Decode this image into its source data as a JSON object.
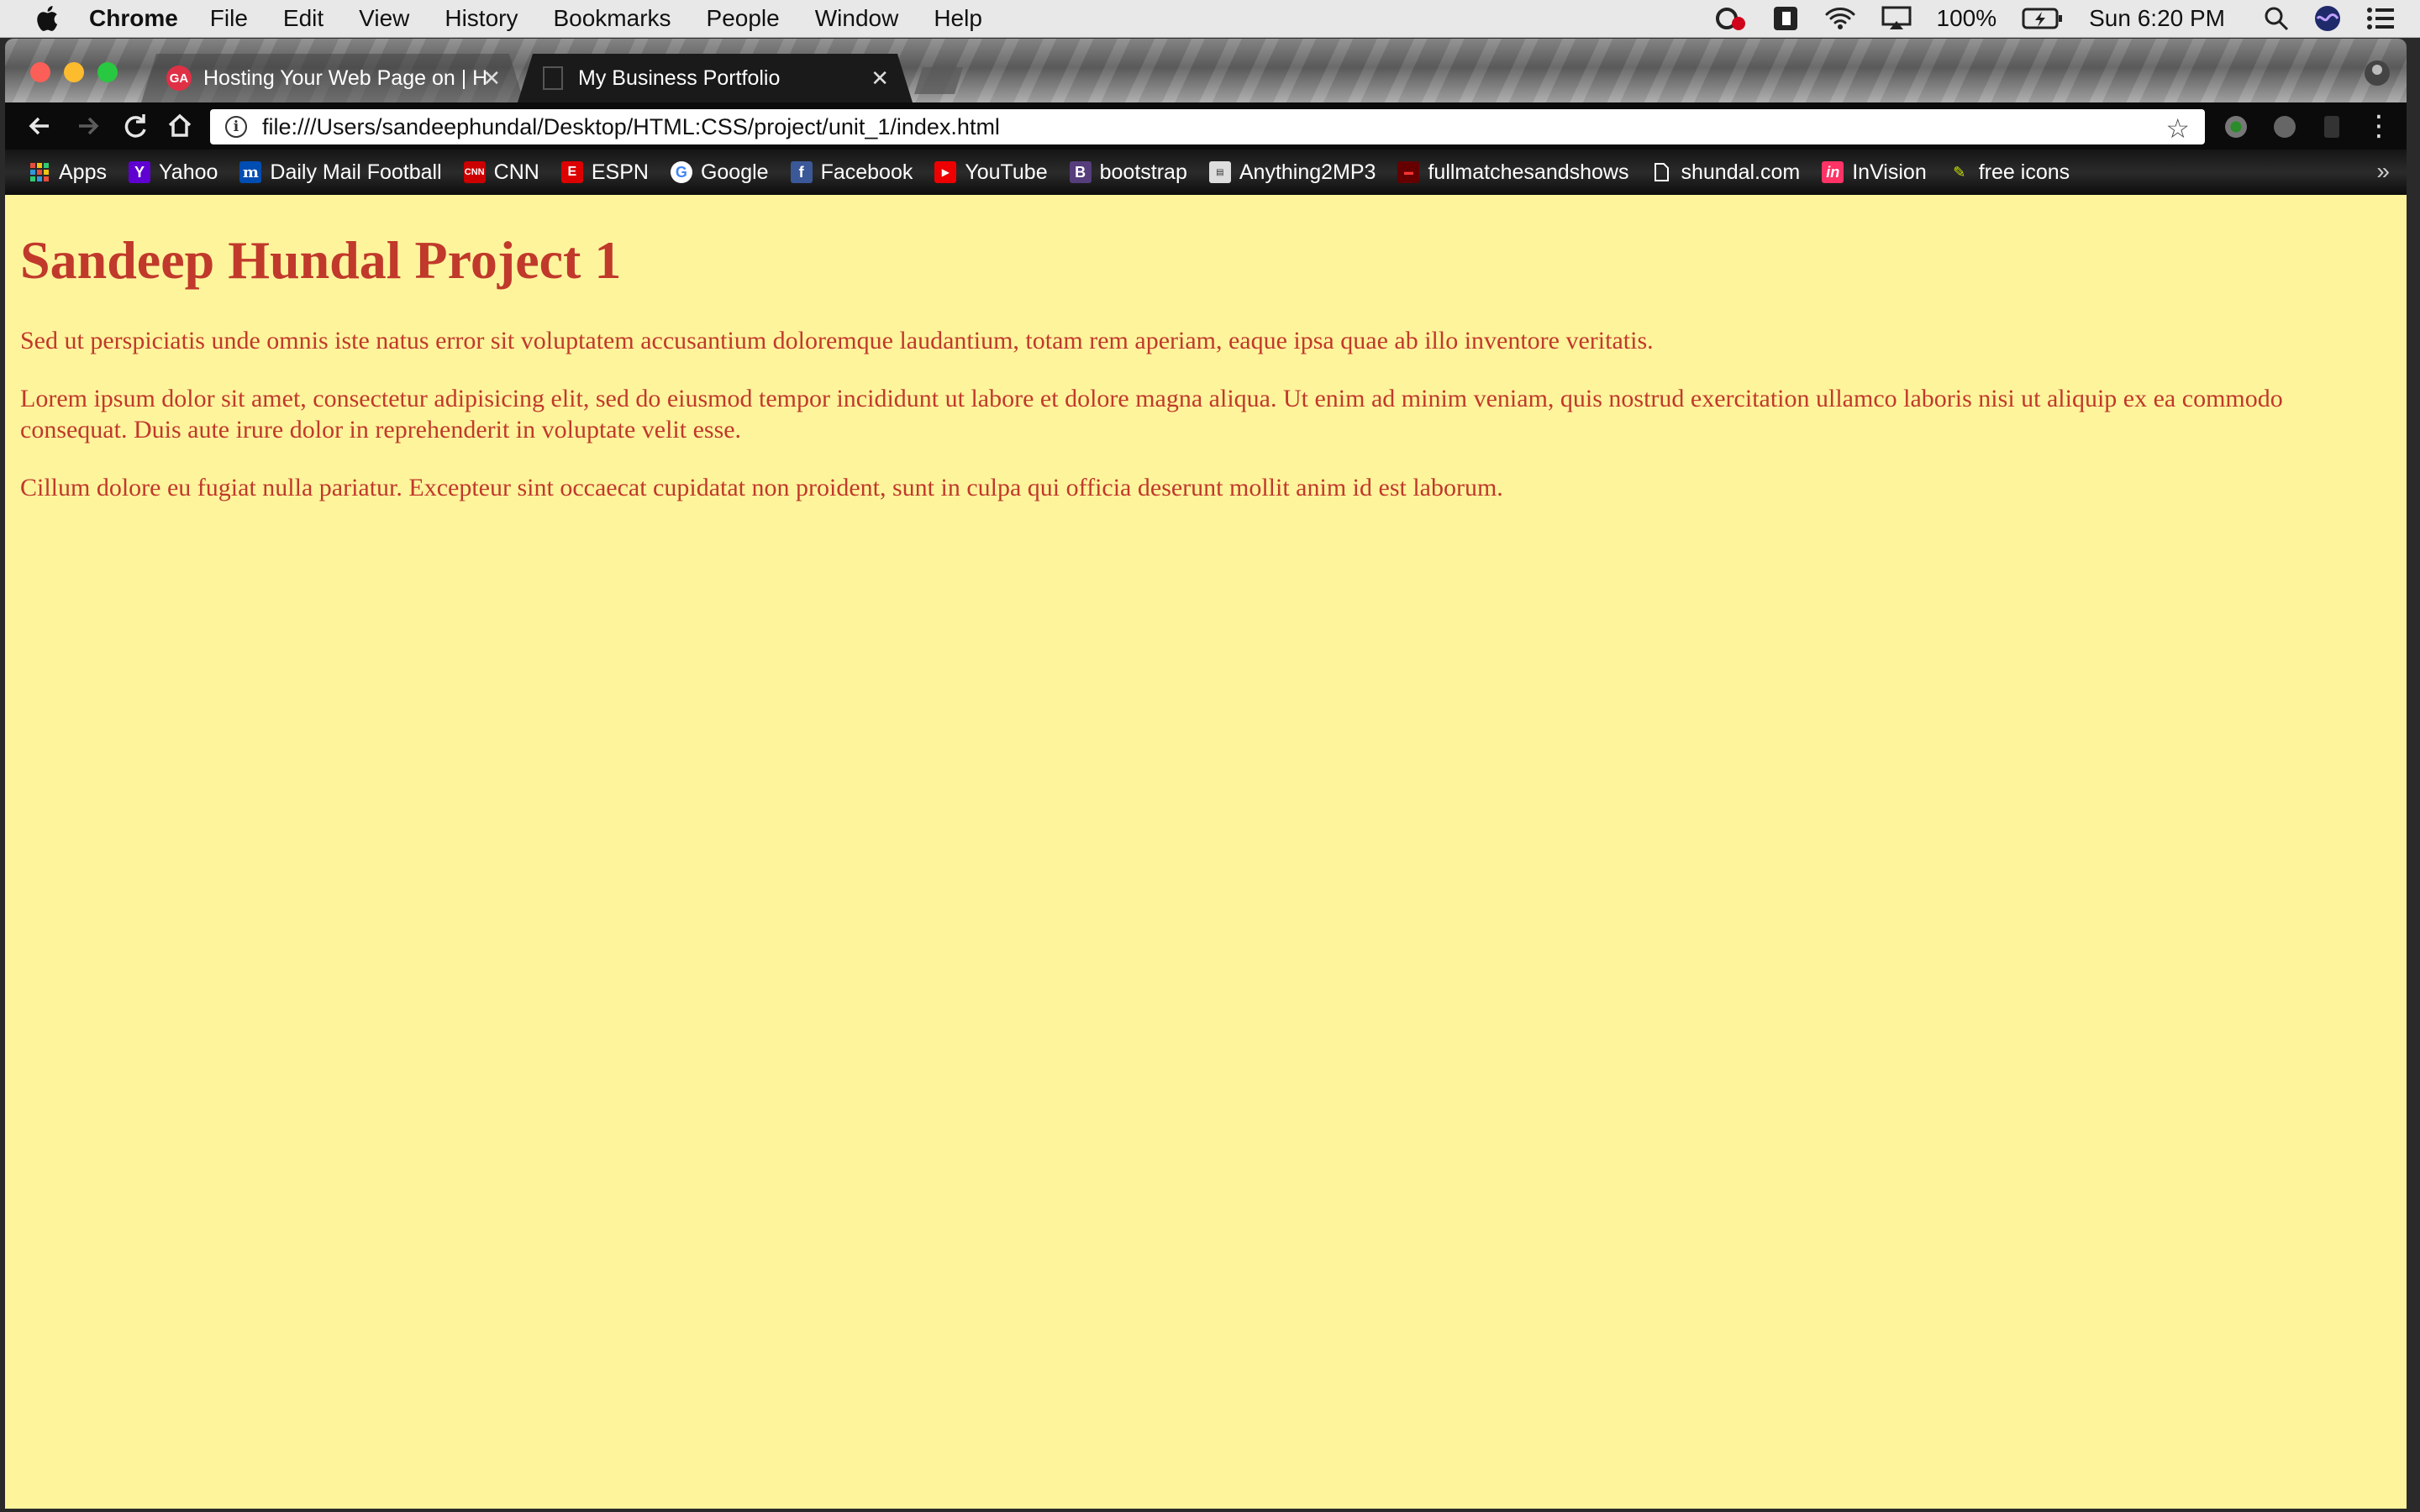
{
  "menubar": {
    "app_name": "Chrome",
    "items": [
      "File",
      "Edit",
      "View",
      "History",
      "Bookmarks",
      "People",
      "Window",
      "Help"
    ],
    "battery": "100%",
    "clock": "Sun 6:20 PM"
  },
  "tabs": [
    {
      "title": "Hosting Your Web Page on | H",
      "favicon": "GA",
      "active": false
    },
    {
      "title": "My Business Portfolio",
      "active": true
    }
  ],
  "toolbar": {
    "url": "file:///Users/sandeephundal/Desktop/HTML:CSS/project/unit_1/index.html"
  },
  "bookmarks": [
    {
      "label": "Apps",
      "icon": "apps-grid-icon"
    },
    {
      "label": "Yahoo",
      "icon": "yahoo-icon"
    },
    {
      "label": "Daily Mail Football",
      "icon": "dailymail-icon"
    },
    {
      "label": "CNN",
      "icon": "cnn-icon"
    },
    {
      "label": "ESPN",
      "icon": "espn-icon"
    },
    {
      "label": "Google",
      "icon": "google-icon"
    },
    {
      "label": "Facebook",
      "icon": "facebook-icon"
    },
    {
      "label": "YouTube",
      "icon": "youtube-icon"
    },
    {
      "label": "bootstrap",
      "icon": "bootstrap-icon"
    },
    {
      "label": "Anything2MP3",
      "icon": "anything2mp3-icon"
    },
    {
      "label": "fullmatchesandshows",
      "icon": "fullmatches-icon"
    },
    {
      "label": "shundal.com",
      "icon": "page-icon"
    },
    {
      "label": "InVision",
      "icon": "invision-icon"
    },
    {
      "label": "free icons",
      "icon": "pencil-icon"
    }
  ],
  "page": {
    "heading": "Sandeep Hundal Project 1",
    "paragraphs": [
      "Sed ut perspiciatis unde omnis iste natus error sit voluptatem accusantium doloremque laudantium, totam rem aperiam, eaque ipsa quae ab illo inventore veritatis.",
      "Lorem ipsum dolor sit amet, consectetur adipisicing elit, sed do eiusmod tempor incididunt ut labore et dolore magna aliqua. Ut enim ad minim veniam, quis nostrud exercitation ullamco laboris nisi ut aliquip ex ea commodo consequat. Duis aute irure dolor in reprehenderit in voluptate velit esse.",
      "Cillum dolore eu fugiat nulla pariatur. Excepteur sint occaecat cupidatat non proident, sunt in culpa qui officia deserunt mollit anim id est laborum."
    ]
  },
  "colors": {
    "page_background": "#fef49c",
    "text": "#c0392b"
  }
}
